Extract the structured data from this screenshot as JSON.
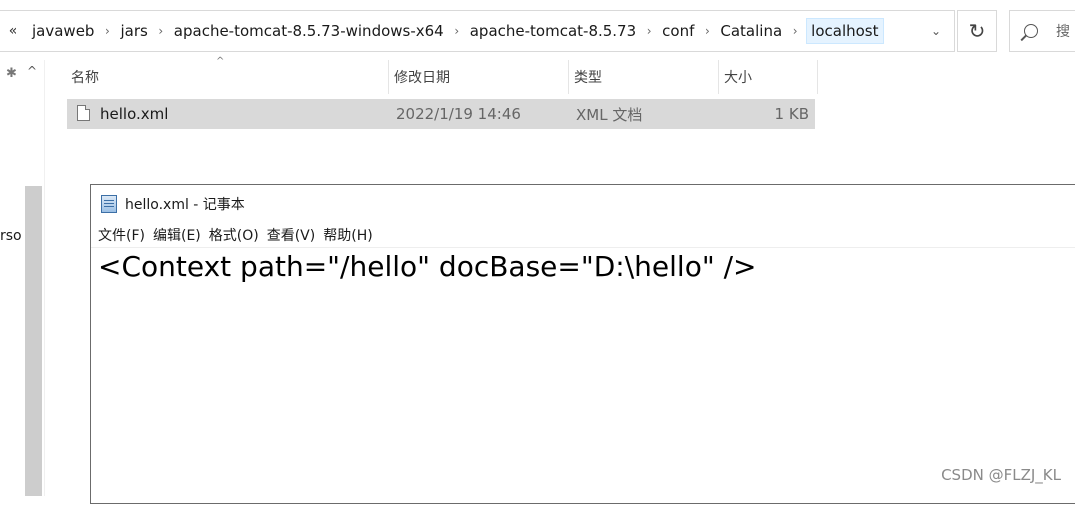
{
  "address_bar": {
    "overflow": "«",
    "crumbs": [
      "javaweb",
      "jars",
      "apache-tomcat-8.5.73-windows-x64",
      "apache-tomcat-8.5.73",
      "conf",
      "Catalina",
      "localhost"
    ],
    "separator": "›",
    "dropdown": "⌄",
    "refresh": "↻",
    "search_placeholder": "搜"
  },
  "nav_pane": {
    "pin_icon": "📌",
    "up": "^",
    "visible_text": "rso"
  },
  "file_list": {
    "sort_indicator": "^",
    "columns": [
      "名称",
      "修改日期",
      "类型",
      "大小"
    ],
    "rows": [
      {
        "name": "hello.xml",
        "modified": "2022/1/19 14:46",
        "type": "XML 文档",
        "size": "1 KB"
      }
    ]
  },
  "notepad": {
    "title": "hello.xml - 记事本",
    "menu": [
      "文件(F)",
      "编辑(E)",
      "格式(O)",
      "查看(V)",
      "帮助(H)"
    ],
    "content": "<Context path=\"/hello\" docBase=\"D:\\hello\" />"
  },
  "watermark": "CSDN @FLZJ_KL"
}
